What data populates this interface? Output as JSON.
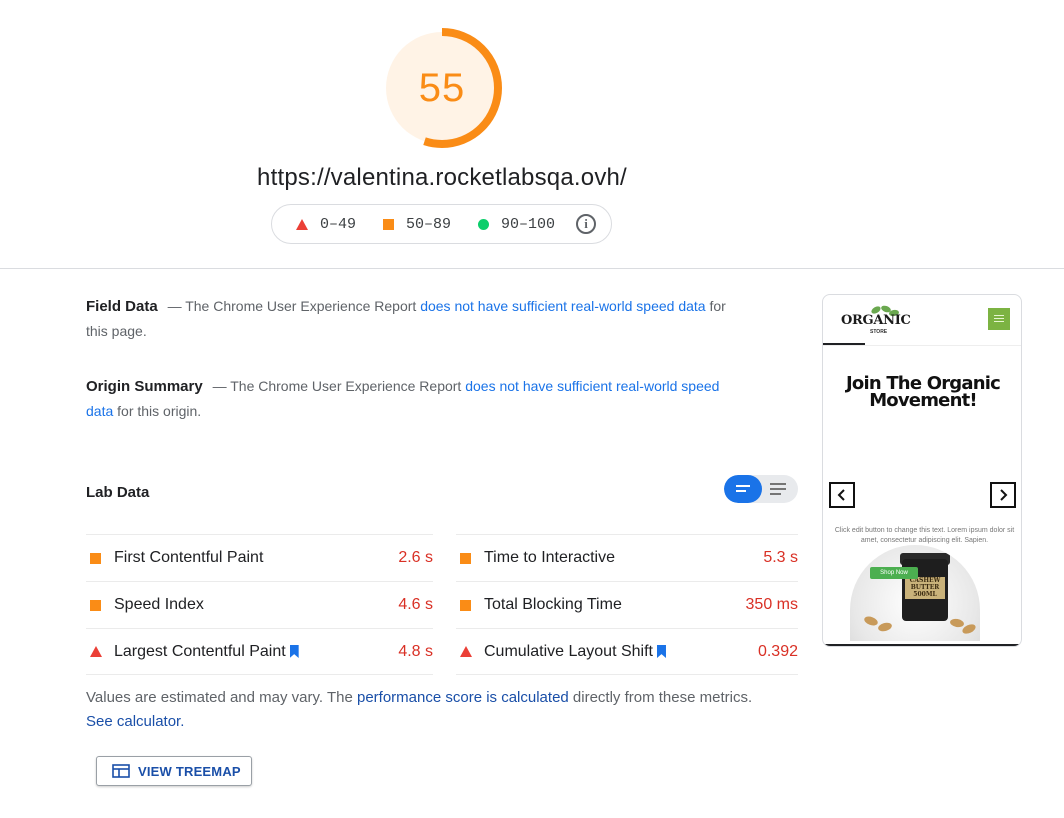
{
  "score": {
    "value": "55",
    "fraction": 0.55,
    "color": "#fa8c16"
  },
  "url": "https://valentina.rocketlabsqa.ovh/",
  "legend": {
    "fail": "0–49",
    "average": "50–89",
    "pass": "90–100",
    "colors": {
      "fail": "#eb3f36",
      "average": "#fa8c16",
      "pass": "#0cce6b"
    }
  },
  "field_data": {
    "title": "Field Data",
    "text_before": "— The Chrome User Experience Report",
    "link": "does not have sufficient real-world speed data",
    "text_after": "for this page."
  },
  "origin_summary": {
    "title": "Origin Summary",
    "text_before": "— The Chrome User Experience Report",
    "link": "does not have sufficient real-world speed data",
    "text_after": "for this origin."
  },
  "lab_data": {
    "title": "Lab Data",
    "metrics_left": [
      {
        "name": "First Contentful Paint",
        "value": "2.6 s",
        "rating": "average",
        "bookmark": false
      },
      {
        "name": "Speed Index",
        "value": "4.6 s",
        "rating": "average",
        "bookmark": false
      },
      {
        "name": "Largest Contentful Paint",
        "value": "4.8 s",
        "rating": "fail",
        "bookmark": true
      }
    ],
    "metrics_right": [
      {
        "name": "Time to Interactive",
        "value": "5.3 s",
        "rating": "average",
        "bookmark": false
      },
      {
        "name": "Total Blocking Time",
        "value": "350 ms",
        "rating": "average",
        "bookmark": false
      },
      {
        "name": "Cumulative Layout Shift",
        "value": "0.392",
        "rating": "fail",
        "bookmark": true
      }
    ]
  },
  "note": {
    "text_before": "Values are estimated and may vary. The",
    "link1": "performance score is calculated",
    "text_middle": "directly from these metrics.",
    "link2": "See calculator."
  },
  "treemap_button": "VIEW TREEMAP",
  "thumbnail": {
    "logo": "ORGANIC",
    "logo_sub": "STORE",
    "hero_line1": "Join The Organic",
    "hero_line2": "Movement!",
    "small_text": "Click edit button to change this text. Lorem ipsum dolor sit amet, consectetur adipiscing elit. Sapien.",
    "shop_button": "Shop Now",
    "jar_line1": "CASHEW",
    "jar_line2": "BUTTER",
    "jar_line3": "500ML"
  }
}
